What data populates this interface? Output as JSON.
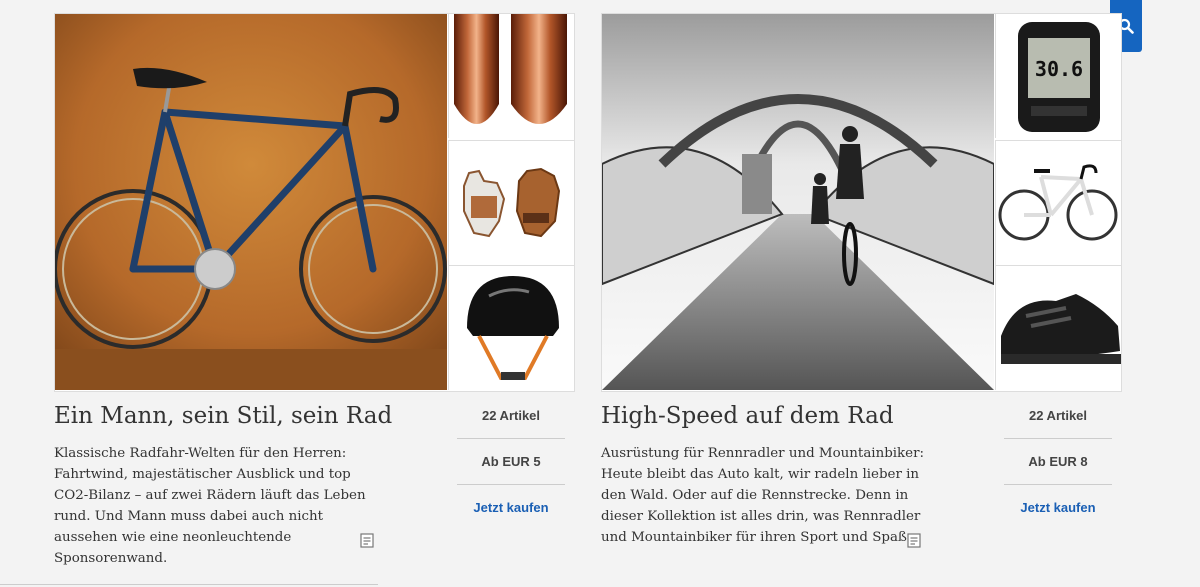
{
  "cards": [
    {
      "title": "Ein Mann, sein Stil, sein Rad",
      "description": "Klassische Radfahr-Welten für den Herren: Fahrtwind, majestätischer Ausblick und top CO2-Bilanz – auf zwei Rädern läuft das Leben rund. Und Mann muss dabei auch nicht aussehen wie eine neonleuchtende Sponsorenwand.",
      "article_count": "22 Artikel",
      "price": "Ab EUR 5",
      "buy_label": "Jetzt kaufen",
      "thumbs": [
        "copper-pipe-icon",
        "cycling-gloves-icon",
        "helmet-icon"
      ]
    },
    {
      "title": "High-Speed auf dem Rad",
      "description": "Ausrüstung für Rennradler und Mountainbiker: Heute bleibt das Auto kalt, wir radeln lieber in den Wald. Oder auf die Rennstrecke. Denn in dieser Kollektion ist alles drin, was Rennradler und Mountainbiker für ihren Sport und Spaß",
      "article_count": "22 Artikel",
      "price": "Ab EUR 8",
      "buy_label": "Jetzt kaufen",
      "thumbs": [
        "bike-computer-icon",
        "road-bike-icon",
        "cycling-shoe-icon"
      ]
    }
  ],
  "search": {
    "icon": "search-icon",
    "color": "#1565c0"
  },
  "colors": {
    "link": "#1a5fb4",
    "text": "#333333",
    "background": "#f3f3f3"
  }
}
